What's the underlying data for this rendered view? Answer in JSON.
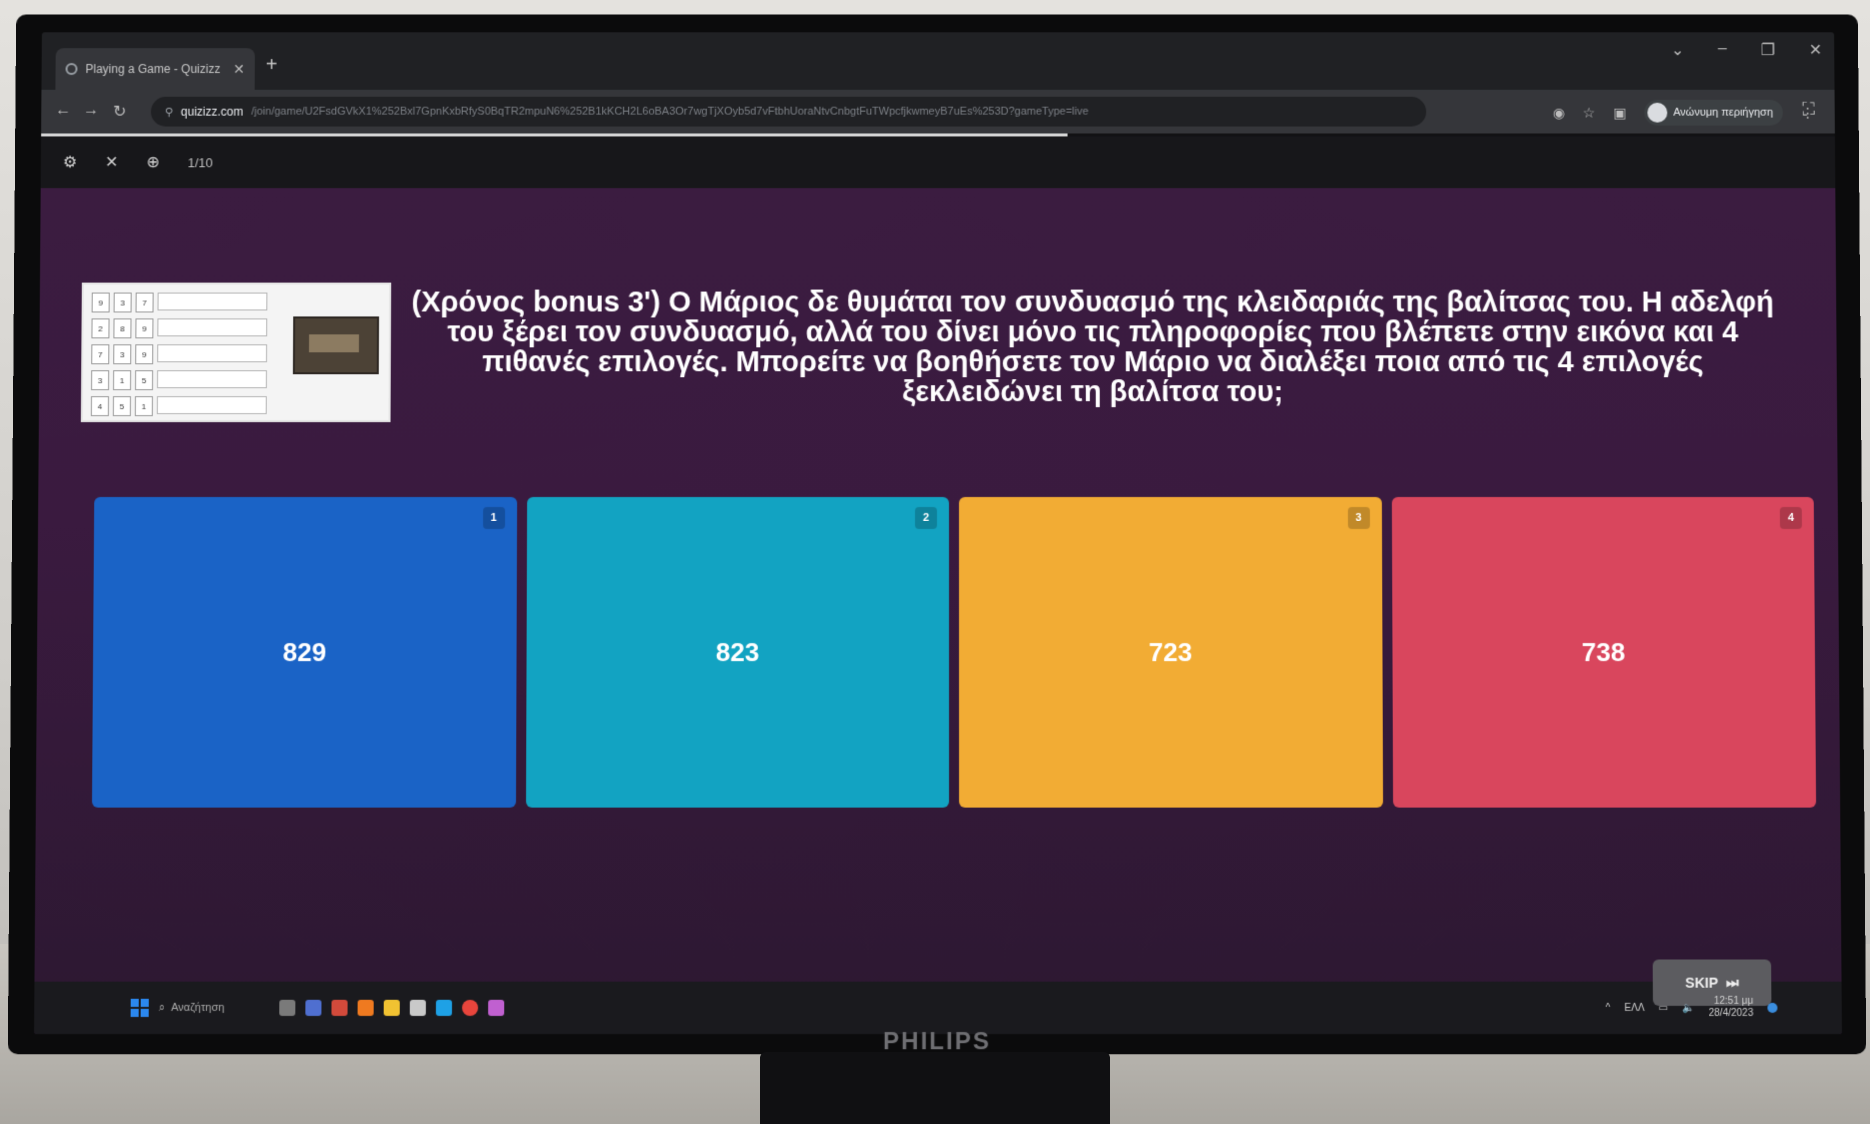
{
  "browser": {
    "tab_title": "Playing a Game - Quizizz",
    "url_host": "quizizz.com",
    "url_rest": "/join/game/U2FsdGVkX1%252Bxl7GpnKxbRfyS0BqTR2mpuN6%252B1kKCH2L6oBA3Or7wgTjXOyb5d7vFtbhUoraNtvCnbgtFuTWpcfjkwmeyB7uEs%253D?gameType=live",
    "profile_label": "Ανώνυμη περιήγηση"
  },
  "quiz": {
    "counter": "1/10",
    "question": "(Χρόνος bonus 3') Ο Μάριος δε θυμάται τον συνδυασμό της κλειδαριάς της βαλίτσας του. Η αδελφή του ξέρει τον συνδυασμό, αλλά του δίνει μόνο τις πληροφορίες που βλέπετε στην εικόνα και 4 πιθανές επιλογές. Μπορείτε να βοηθήσετε τον Μάριο να διαλέξει ποια από τις 4 επιλογές ξεκλειδώνει τη βαλίτσα του;",
    "image_rows": [
      {
        "digits": [
          "9",
          "3",
          "7"
        ]
      },
      {
        "digits": [
          "2",
          "8",
          "9"
        ]
      },
      {
        "digits": [
          "7",
          "3",
          "9"
        ]
      },
      {
        "digits": [
          "3",
          "1",
          "5"
        ]
      },
      {
        "digits": [
          "4",
          "5",
          "1"
        ]
      }
    ],
    "options": [
      {
        "num": "1",
        "text": "829",
        "color": "#1a63c6"
      },
      {
        "num": "2",
        "text": "823",
        "color": "#12a3c2"
      },
      {
        "num": "3",
        "text": "723",
        "color": "#f2ac34"
      },
      {
        "num": "4",
        "text": "738",
        "color": "#d9465d"
      }
    ],
    "skip_label": "SKIP"
  },
  "taskbar": {
    "search_label": "Αναζήτηση",
    "lang": "ΕΛΛ",
    "time": "12:51 μμ",
    "date": "28/4/2023"
  },
  "monitor": {
    "brand": "PHILIPS"
  }
}
